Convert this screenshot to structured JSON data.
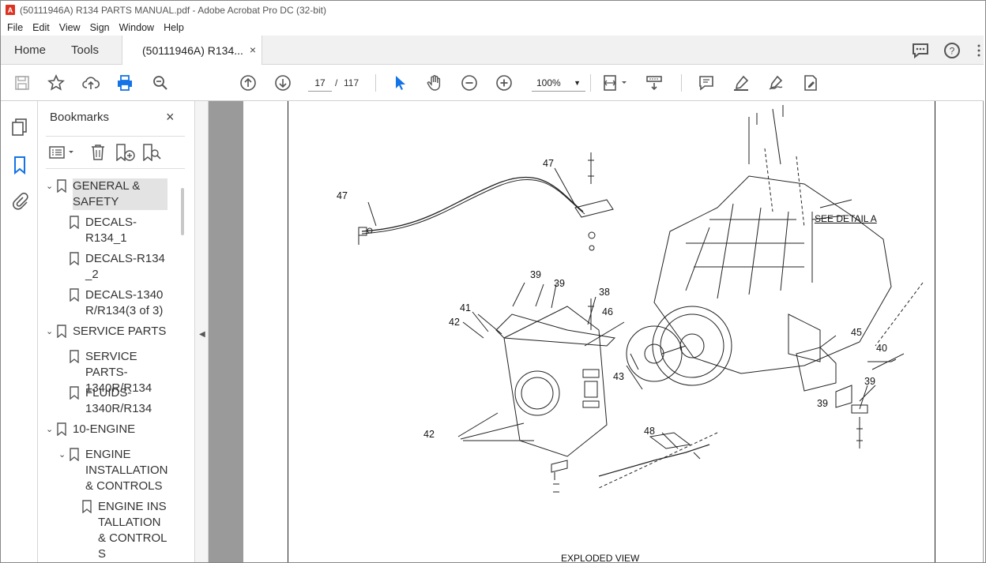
{
  "window": {
    "title": "(50111946A) R134 PARTS MANUAL.pdf - Adobe Acrobat Pro DC (32-bit)"
  },
  "menu": [
    "File",
    "Edit",
    "View",
    "Sign",
    "Window",
    "Help"
  ],
  "tabs": {
    "home": "Home",
    "tools": "Tools",
    "document": "(50111946A) R134...",
    "close": "×"
  },
  "toolbar": {
    "current_page": "17",
    "page_separator": "/",
    "total_pages": "117",
    "zoom": "100%"
  },
  "bookmarks": {
    "title": "Bookmarks",
    "close": "×",
    "items": [
      {
        "label": "GENERAL & SAFETY",
        "level": 0,
        "expanded": true,
        "selected": true
      },
      {
        "label": "DECALS-R134_1",
        "level": 1
      },
      {
        "label": "DECALS-R134_2",
        "level": 1
      },
      {
        "label": "DECALS-1340R/R134(3 of 3)",
        "level": 1
      },
      {
        "label": "SERVICE PARTS",
        "level": 0,
        "expanded": true
      },
      {
        "label": "SERVICE PARTS-1340R/R134",
        "level": 1
      },
      {
        "label": "FLUIDS-1340R/R134",
        "level": 1
      },
      {
        "label": "10-ENGINE",
        "level": 0,
        "expanded": true
      },
      {
        "label": "ENGINE INSTALLATION & CONTROLS",
        "level": 1,
        "expanded": true
      },
      {
        "label": "ENGINE INSTALLATION & CONTROLS",
        "level": 2
      }
    ]
  },
  "drawing": {
    "see_detail": "SEE DETAIL A",
    "caption": "EXPLODED VIEW",
    "callouts": [
      "47",
      "47",
      "39",
      "39",
      "38",
      "41",
      "46",
      "42",
      "43",
      "45",
      "40",
      "39",
      "39",
      "42",
      "48"
    ]
  }
}
